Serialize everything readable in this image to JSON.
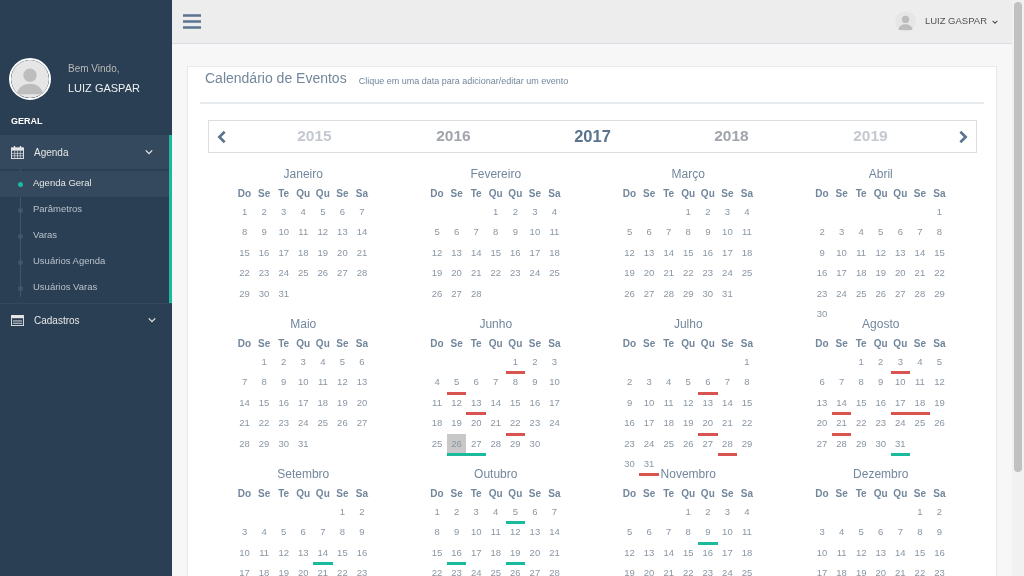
{
  "sidebar": {
    "welcome": "Bem Vindo,",
    "user_name": "LUIZ GASPAR",
    "section_label": "GERAL",
    "menu": [
      {
        "label": "Agenda",
        "expanded": true,
        "children": [
          {
            "label": "Agenda Geral",
            "selected": true
          },
          {
            "label": "Parâmetros",
            "selected": false
          },
          {
            "label": "Varas",
            "selected": false
          },
          {
            "label": "Usuários Agenda",
            "selected": false
          },
          {
            "label": "Usuários Varas",
            "selected": false
          }
        ]
      },
      {
        "label": "Cadastros",
        "expanded": false
      }
    ]
  },
  "header": {
    "user_name": "LUIZ GASPAR"
  },
  "panel": {
    "title": "Calendário de Eventos",
    "subtitle": "Clique em uma data para adicionar/editar um evento",
    "years": [
      {
        "label": "2015",
        "selected": false,
        "dimmed": true
      },
      {
        "label": "2016",
        "selected": false,
        "dimmed": false
      },
      {
        "label": "2017",
        "selected": true,
        "dimmed": false
      },
      {
        "label": "2018",
        "selected": false,
        "dimmed": false
      },
      {
        "label": "2019",
        "selected": false,
        "dimmed": true
      }
    ],
    "months": [
      {
        "name": "Janeiro",
        "weekdays": [
          "Do",
          "Se",
          "Te",
          "Qu",
          "Qu",
          "Se",
          "Sa"
        ],
        "weeks": [
          [
            "1",
            "2",
            "3",
            "4",
            "5",
            "6",
            "7"
          ],
          [
            "8",
            "9",
            "10",
            "11",
            "12",
            "13",
            "14"
          ],
          [
            "15",
            "16",
            "17",
            "18",
            "19",
            "20",
            "21"
          ],
          [
            "22",
            "23",
            "24",
            "25",
            "26",
            "27",
            "28"
          ],
          [
            "29",
            "30",
            "31"
          ]
        ]
      },
      {
        "name": "Fevereiro",
        "weekdays": [
          "Do",
          "Se",
          "Te",
          "Qu",
          "Qu",
          "Se",
          "Sa"
        ],
        "weeks": [
          [
            "1",
            "2",
            "3",
            "4"
          ],
          [
            "5",
            "6",
            "7",
            "8",
            "9",
            "10",
            "11"
          ],
          [
            "12",
            "13",
            "14",
            "15",
            "16",
            "17",
            "18"
          ],
          [
            "19",
            "20",
            "21",
            "22",
            "23",
            "24",
            "25"
          ],
          [
            "26",
            "27",
            "28"
          ]
        ]
      },
      {
        "name": "Março",
        "weekdays": [
          "Do",
          "Se",
          "Te",
          "Qu",
          "Qu",
          "Se",
          "Sa"
        ],
        "weeks": [
          [
            "1",
            "2",
            "3",
            "4"
          ],
          [
            "5",
            "6",
            "7",
            "8",
            "9",
            "10",
            "11"
          ],
          [
            "12",
            "13",
            "14",
            "15",
            "16",
            "17",
            "18"
          ],
          [
            "19",
            "20",
            "21",
            "22",
            "23",
            "24",
            "25"
          ],
          [
            "26",
            "27",
            "28",
            "29",
            "30",
            "31"
          ]
        ]
      },
      {
        "name": "Abril",
        "weekdays": [
          "Do",
          "Se",
          "Te",
          "Qu",
          "Qu",
          "Se",
          "Sa"
        ],
        "weeks": [
          [
            "1"
          ],
          [
            "2",
            "3",
            "4",
            "5",
            "6",
            "7",
            "8"
          ],
          [
            "9",
            "10",
            "11",
            "12",
            "13",
            "14",
            "15"
          ],
          [
            "16",
            "17",
            "18",
            "19",
            "20",
            "21",
            "22"
          ],
          [
            "23",
            "24",
            "25",
            "26",
            "27",
            "28",
            "29"
          ],
          [
            "30"
          ]
        ]
      },
      {
        "name": "Maio",
        "weekdays": [
          "Do",
          "Se",
          "Te",
          "Qu",
          "Qu",
          "Se",
          "Sa"
        ],
        "weeks": [
          [
            "1",
            "2",
            "3",
            "4",
            "5",
            "6"
          ],
          [
            "7",
            "8",
            "9",
            "10",
            "11",
            "12",
            "13"
          ],
          [
            "14",
            "15",
            "16",
            "17",
            "18",
            "19",
            "20"
          ],
          [
            "21",
            "22",
            "23",
            "24",
            "25",
            "26",
            "27"
          ],
          [
            "28",
            "29",
            "30",
            "31"
          ]
        ]
      },
      {
        "name": "Junho",
        "weekdays": [
          "Do",
          "Se",
          "Te",
          "Qu",
          "Qu",
          "Se",
          "Sa"
        ],
        "weeks": [
          [
            {
              "day": "1",
              "color": "#d9534f"
            },
            "2",
            "3"
          ],
          [
            "4",
            {
              "day": "5",
              "color": "#d9534f"
            },
            "6",
            "7",
            "8",
            "9",
            "10"
          ],
          [
            "11",
            "12",
            {
              "day": "13",
              "color": "#d9534f"
            },
            "14",
            "15",
            "16",
            "17"
          ],
          [
            "18",
            "19",
            "20",
            "21",
            {
              "day": "22",
              "color": "#d9534f"
            },
            "23",
            "24"
          ],
          [
            "25",
            {
              "day": "26",
              "color": "#1abb9c",
              "highlighted": true
            },
            {
              "day": "27",
              "color": "#1abb9c"
            },
            "28",
            "29",
            "30"
          ]
        ]
      },
      {
        "name": "Julho",
        "weekdays": [
          "Do",
          "Se",
          "Te",
          "Qu",
          "Qu",
          "Se",
          "Sa"
        ],
        "weeks": [
          [
            "1"
          ],
          [
            "2",
            "3",
            "4",
            "5",
            {
              "day": "6",
              "color": "#d9534f"
            },
            "7",
            "8"
          ],
          [
            "9",
            "10",
            "11",
            "12",
            "13",
            "14",
            "15"
          ],
          [
            "16",
            "17",
            "18",
            "19",
            {
              "day": "20",
              "color": "#d9534f"
            },
            "21",
            "22"
          ],
          [
            "23",
            "24",
            "25",
            "26",
            "27",
            {
              "day": "28",
              "color": "#d9534f"
            },
            "29"
          ],
          [
            "30",
            {
              "day": "31",
              "color": "#d9534f"
            }
          ]
        ]
      },
      {
        "name": "Agosto",
        "weekdays": [
          "Do",
          "Se",
          "Te",
          "Qu",
          "Qu",
          "Se",
          "Sa"
        ],
        "weeks": [
          [
            "1",
            "2",
            {
              "day": "3",
              "color": "#d9534f"
            },
            "4",
            "5"
          ],
          [
            "6",
            "7",
            "8",
            "9",
            "10",
            "11",
            "12"
          ],
          [
            "13",
            {
              "day": "14",
              "color": "#d9534f"
            },
            "15",
            "16",
            {
              "day": "17",
              "color": "#d9534f"
            },
            {
              "day": "18",
              "color": "#d9534f"
            },
            "19"
          ],
          [
            "20",
            {
              "day": "21",
              "color": "#d9534f"
            },
            "22",
            "23",
            "24",
            "25",
            "26"
          ],
          [
            "27",
            "28",
            "29",
            "30",
            {
              "day": "31",
              "color": "#1abb9c"
            }
          ]
        ]
      },
      {
        "name": "Setembro",
        "weekdays": [
          "Do",
          "Se",
          "Te",
          "Qu",
          "Qu",
          "Se",
          "Sa"
        ],
        "weeks": [
          [
            "1",
            "2"
          ],
          [
            "3",
            "4",
            "5",
            "6",
            "7",
            "8",
            "9"
          ],
          [
            "10",
            "11",
            "12",
            "13",
            {
              "day": "14",
              "color": "#1abb9c"
            },
            "15",
            "16"
          ],
          [
            "17",
            "18",
            "19",
            "20",
            "21",
            "22",
            "23"
          ]
        ]
      },
      {
        "name": "Outubro",
        "weekdays": [
          "Do",
          "Se",
          "Te",
          "Qu",
          "Qu",
          "Se",
          "Sa"
        ],
        "weeks": [
          [
            "1",
            "2",
            "3",
            "4",
            {
              "day": "5",
              "color": "#1abb9c"
            },
            "6",
            "7"
          ],
          [
            "8",
            "9",
            "10",
            "11",
            "12",
            "13",
            "14"
          ],
          [
            "15",
            {
              "day": "16",
              "color": "#1abb9c"
            },
            "17",
            "18",
            {
              "day": "19",
              "color": "#1abb9c"
            },
            "20",
            "21"
          ],
          [
            "22",
            "23",
            "24",
            "25",
            "26",
            "27",
            "28"
          ]
        ]
      },
      {
        "name": "Novembro",
        "weekdays": [
          "Do",
          "Se",
          "Te",
          "Qu",
          "Qu",
          "Se",
          "Sa"
        ],
        "weeks": [
          [
            "1",
            "2",
            "3",
            "4"
          ],
          [
            "5",
            "6",
            "7",
            "8",
            {
              "day": "9",
              "color": "#1abb9c"
            },
            "10",
            "11"
          ],
          [
            "12",
            "13",
            "14",
            "15",
            "16",
            "17",
            "18"
          ],
          [
            "19",
            "20",
            "21",
            "22",
            "23",
            "24",
            "25"
          ]
        ]
      },
      {
        "name": "Dezembro",
        "weekdays": [
          "Do",
          "Se",
          "Te",
          "Qu",
          "Qu",
          "Se",
          "Sa"
        ],
        "weeks": [
          [
            "1",
            "2"
          ],
          [
            "3",
            "4",
            "5",
            "6",
            "7",
            "8",
            "9"
          ],
          [
            "10",
            "11",
            "12",
            "13",
            "14",
            "15",
            "16"
          ],
          [
            "17",
            "18",
            "19",
            "20",
            "21",
            "22",
            "23"
          ]
        ]
      }
    ]
  }
}
